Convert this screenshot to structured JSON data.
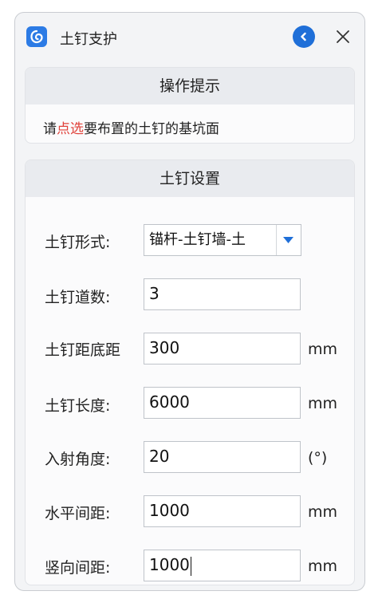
{
  "window": {
    "title": "土钉支护"
  },
  "hint": {
    "header": "操作提示",
    "text_prefix": "请",
    "text_highlight": "点选",
    "text_suffix": "要布置的土钉的基坑面"
  },
  "settings": {
    "header": "土钉设置",
    "nail_type": {
      "label": "土钉形式:",
      "value": "锚杆-土钉墙-土"
    },
    "nail_rows": {
      "label": "土钉道数:",
      "value": "3"
    },
    "bottom_distance": {
      "label": "土钉距底距",
      "value": "300",
      "unit": "mm"
    },
    "nail_length": {
      "label": "土钉长度:",
      "value": "6000",
      "unit": "mm"
    },
    "incidence_angle": {
      "label": "入射角度:",
      "value": "20",
      "unit": "(°)"
    },
    "horizontal_spacing": {
      "label": "水平间距:",
      "value": "1000",
      "unit": "mm"
    },
    "vertical_spacing": {
      "label": "竖向间距:",
      "value": "1000",
      "unit": "mm"
    }
  },
  "colors": {
    "accent": "#1f6fd8",
    "highlight": "#e0413a",
    "app_icon": "#2c7be5"
  },
  "icons": {
    "app": "app-logo-icon",
    "back": "back-icon",
    "close": "close-icon",
    "dropdown": "dropdown-arrow-icon"
  }
}
